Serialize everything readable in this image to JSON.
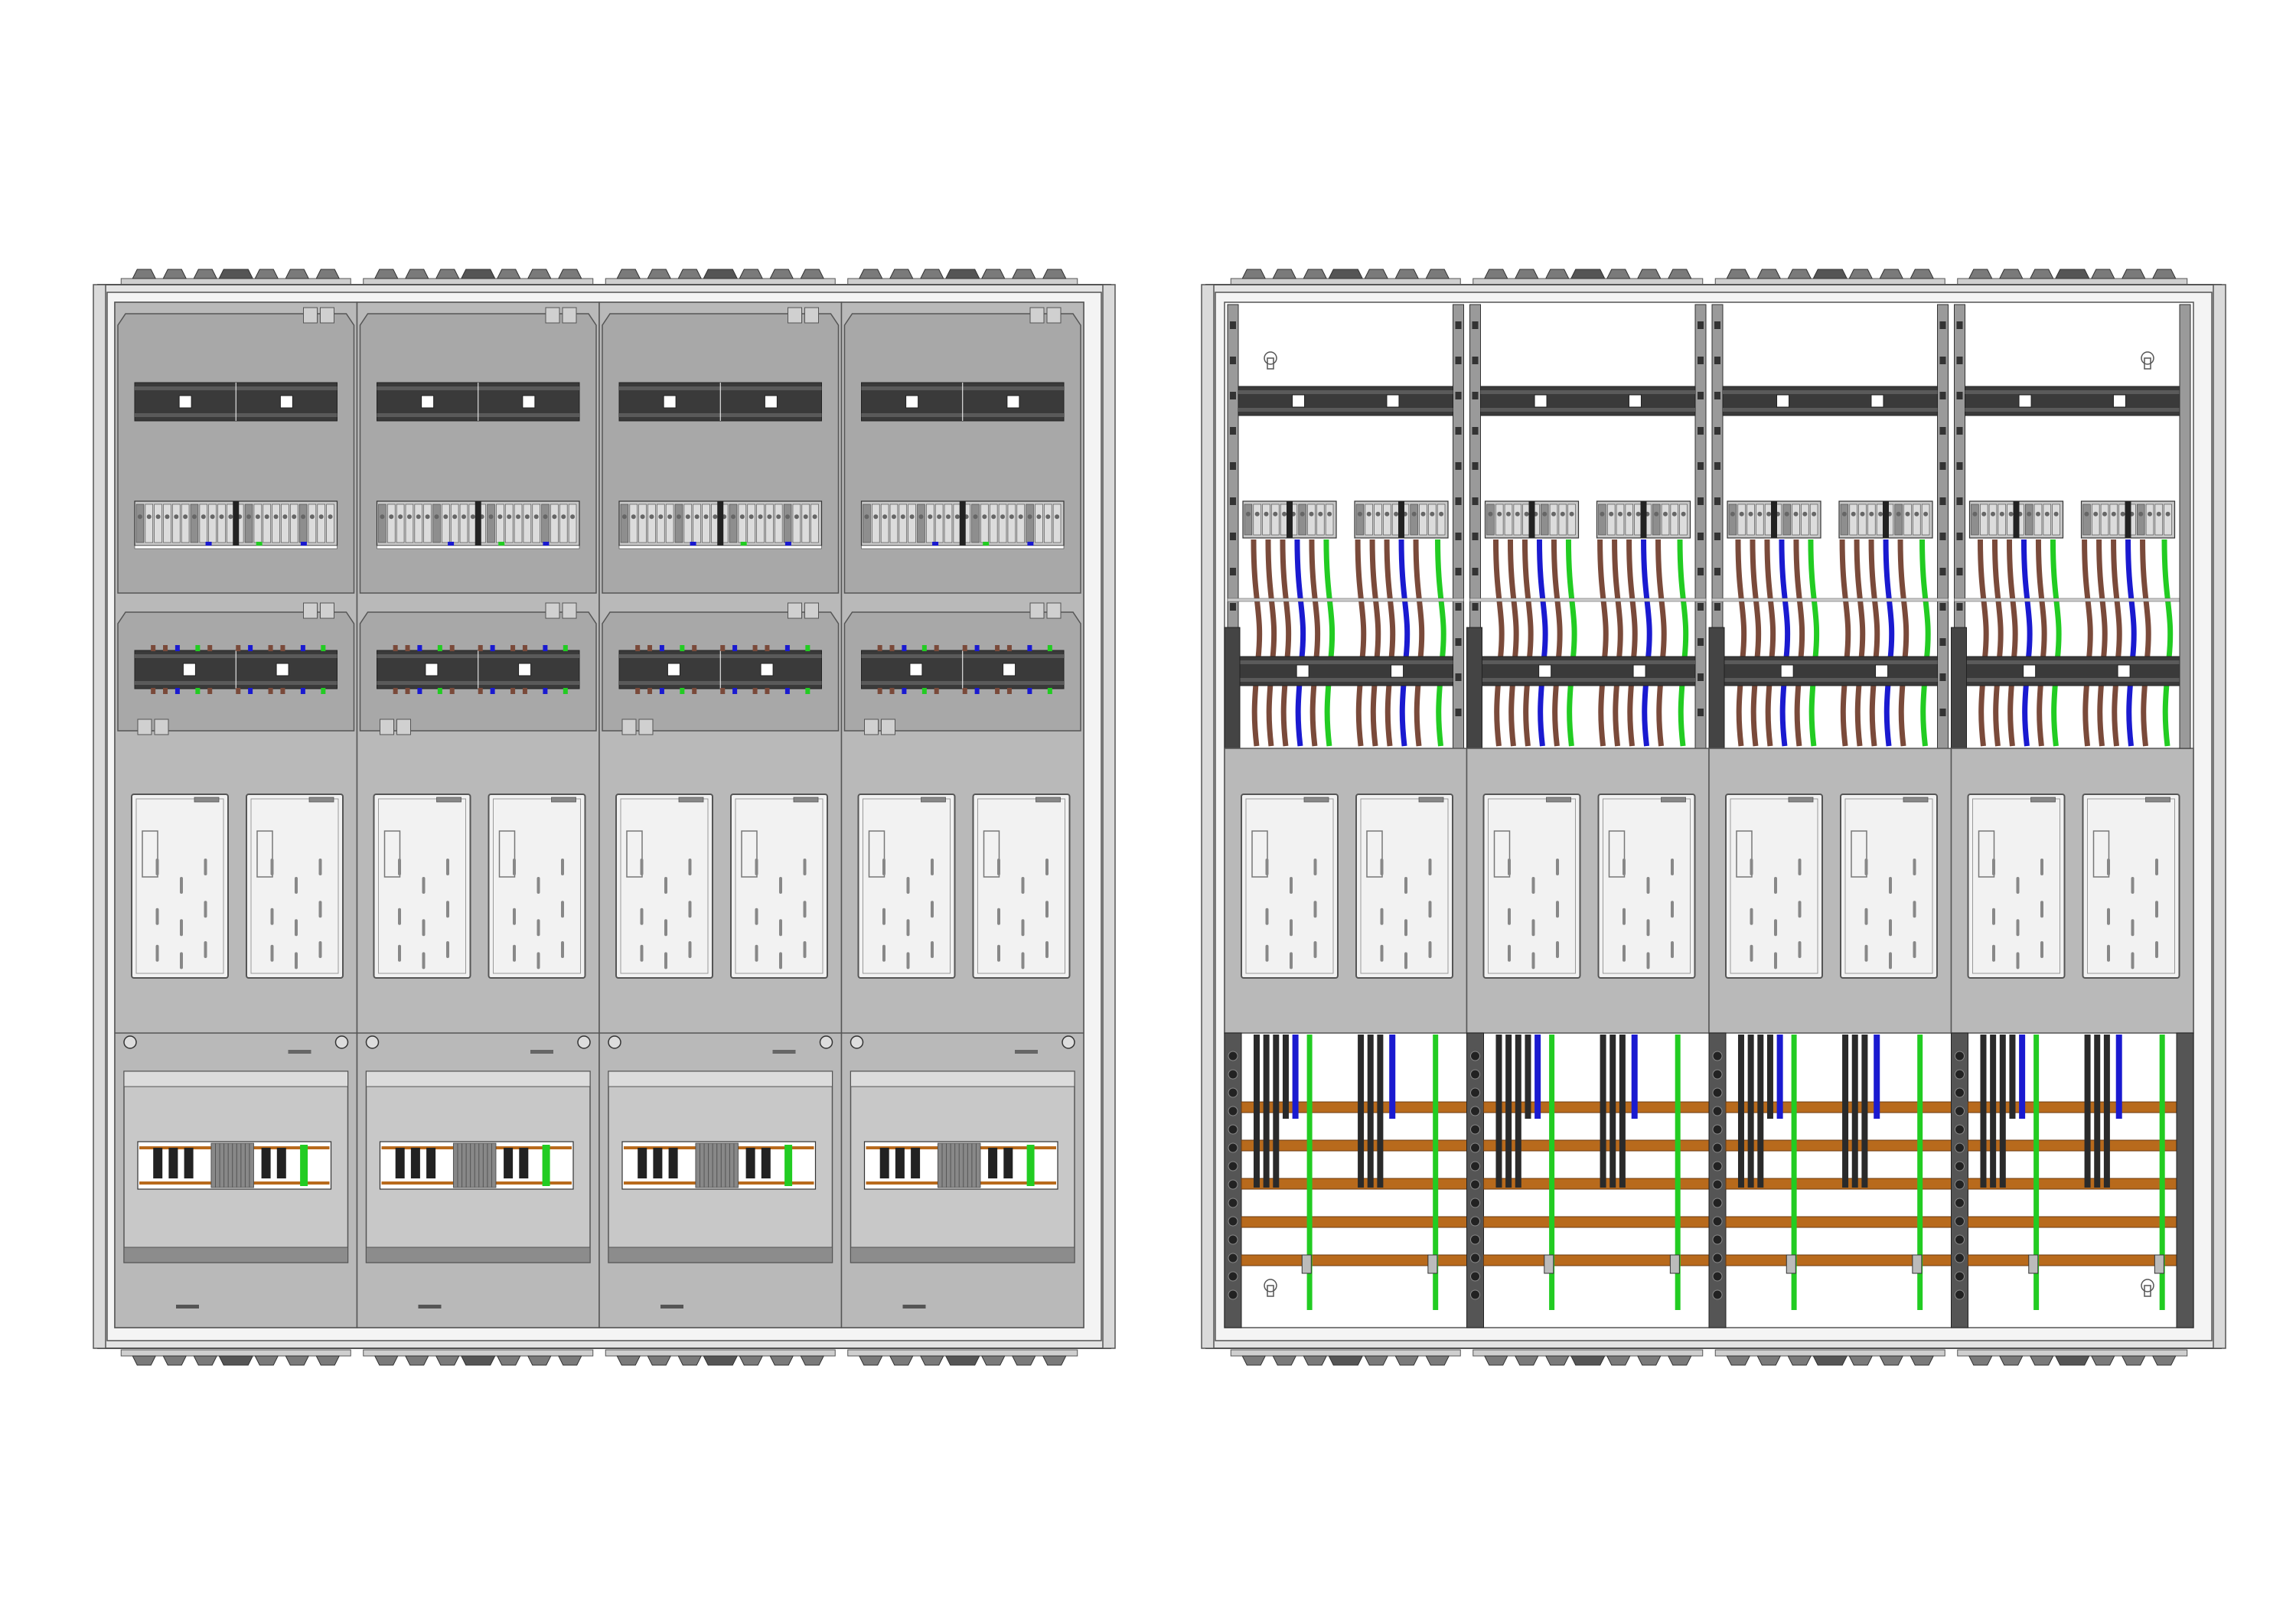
{
  "drawing": {
    "views": [
      {
        "name": "front-view-closed",
        "columns": 4
      },
      {
        "name": "interior-view-open",
        "columns": 4
      }
    ]
  },
  "colors": {
    "background": "#ffffff",
    "panel": "#b9b9b9",
    "panel_dark": "#a8a8a8",
    "frame": "#e4e4e4",
    "rail": "#3a3a3a",
    "outline": "#555555",
    "meter_window": "#f2f2f2",
    "wire_brown": "#7a4a3a",
    "wire_blue": "#1a1ad0",
    "wire_green": "#22cc22",
    "busbar_copper": "#b86a1c",
    "cover_dark": "#8c8c8c",
    "conductor_black": "#2a2a2a"
  }
}
